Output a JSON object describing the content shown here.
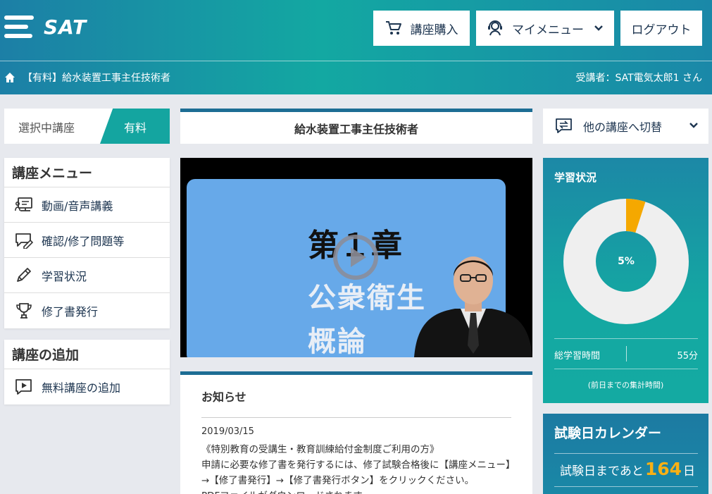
{
  "header": {
    "logo_text": "SAT",
    "buttons": {
      "buy": "講座購入",
      "my_menu": "マイメニュー",
      "logout": "ログアウト"
    },
    "breadcrumb": "【有料】給水装置工事主任技術者",
    "student": "受講者：SAT電気太郎1 さん"
  },
  "left": {
    "selected": {
      "label": "選択中講座",
      "badge": "有料"
    },
    "course_menu": {
      "title": "講座メニュー",
      "items": [
        {
          "label": "動画/音声講義",
          "icon": "video-lecture-icon"
        },
        {
          "label": "確認/修了問題等",
          "icon": "quiz-icon"
        },
        {
          "label": "学習状況",
          "icon": "pencil-icon"
        },
        {
          "label": "修了書発行",
          "icon": "trophy-icon"
        }
      ]
    },
    "add_course": {
      "title": "講座の追加",
      "items": [
        {
          "label": "無料講座の追加",
          "icon": "play-chat-icon"
        }
      ]
    }
  },
  "center": {
    "course_title": "給水装置工事主任技術者",
    "video": {
      "slide_line1": "第１章",
      "slide_line2": "公衆衛生",
      "slide_line3": "概論"
    },
    "news": {
      "title": "お知らせ",
      "date": "2019/03/15",
      "body_line1": "《特別教育の受講生・教育訓練給付金制度ご利用の方》",
      "body_line2": "申請に必要な修了書を発行するには、修了試験合格後に【講座メニュー】→【修了書発行】→【修了書発行ボタン】をクリックください。",
      "body_line3": "PDFファイルがダウンロードされます。"
    }
  },
  "right": {
    "switch_label": "他の講座へ切替",
    "status": {
      "title": "学習状況",
      "progress_percent": 5,
      "progress_label": "5%",
      "total_label": "総学習時間",
      "total_value": "55分",
      "note": "(前日までの集計時間)"
    },
    "calendar": {
      "title": "試験日カレンダー",
      "prefix": "試験日まであと",
      "days": "164",
      "suffix": "日"
    }
  },
  "colors": {
    "teal": "#14a5a0",
    "navy": "#1d6d94",
    "accent": "#f8b014",
    "donut_track": "#efefef",
    "donut_progress": "#f5a800"
  }
}
